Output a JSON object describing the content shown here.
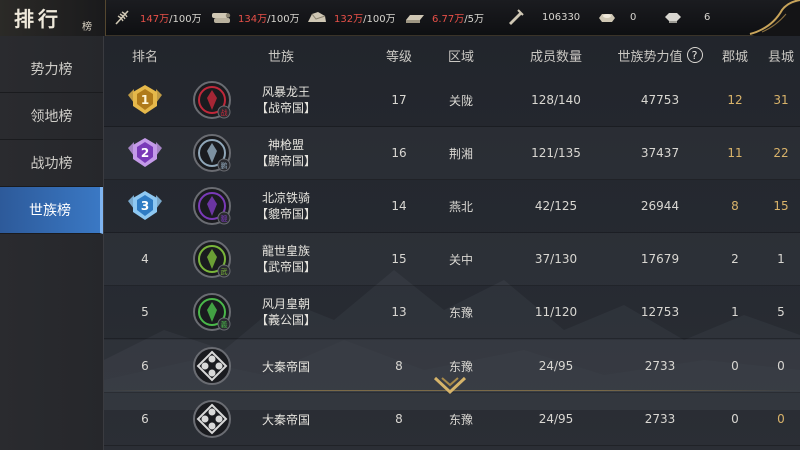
{
  "title": {
    "main": "排行",
    "sub": "榜"
  },
  "resources": [
    {
      "icon": "wheat-icon",
      "current": "147万",
      "max": "/100万"
    },
    {
      "icon": "wood-icon",
      "current": "134万",
      "max": "/100万"
    },
    {
      "icon": "stone-icon",
      "current": "132万",
      "max": "/100万"
    },
    {
      "icon": "iron-icon",
      "current": "6.77万",
      "max": "/5万"
    },
    {
      "icon": "copper-icon",
      "value": "106330"
    },
    {
      "icon": "gold-ingot-icon",
      "value": "0"
    },
    {
      "icon": "silver-ingot-icon",
      "value": "6"
    }
  ],
  "sidebar": {
    "items": [
      {
        "label": "势力榜",
        "active": false
      },
      {
        "label": "领地榜",
        "active": false
      },
      {
        "label": "战功榜",
        "active": false
      },
      {
        "label": "世族榜",
        "active": true
      }
    ]
  },
  "table": {
    "headers": {
      "rank": "排名",
      "clan": "世族",
      "level": "等级",
      "region": "区域",
      "members": "成员数量",
      "power": "世族势力值",
      "power_help": "?",
      "jun": "郡城",
      "xian": "县城"
    },
    "rows": [
      {
        "rank": "1",
        "badge": "gold",
        "name": "风暴龙王",
        "state": "【战帝国】",
        "emblem_char": "战",
        "emblem_color": "#c0283a",
        "level": "17",
        "region": "关陇",
        "members": "128/140",
        "power": "47753",
        "jun": "12",
        "xian": "31"
      },
      {
        "rank": "2",
        "badge": "purple",
        "name": "神枪盟",
        "state": "【鹏帝国】",
        "emblem_char": "鹏",
        "emblem_color": "#8fa6b8",
        "level": "16",
        "region": "荆湘",
        "members": "121/135",
        "power": "37437",
        "jun": "11",
        "xian": "22"
      },
      {
        "rank": "3",
        "badge": "blue",
        "name": "北凉铁骑",
        "state": "【貔帝国】",
        "emblem_char": "貔",
        "emblem_color": "#7a3ab8",
        "level": "14",
        "region": "燕北",
        "members": "42/125",
        "power": "26944",
        "jun": "8",
        "xian": "15"
      },
      {
        "rank": "4",
        "badge": "",
        "name": "龍世皇族",
        "state": "【武帝国】",
        "emblem_char": "武",
        "emblem_color": "#7ab63a",
        "level": "15",
        "region": "关中",
        "members": "37/130",
        "power": "17679",
        "jun": "2",
        "xian": "1"
      },
      {
        "rank": "5",
        "badge": "",
        "name": "风月皇朝",
        "state": "【義公国】",
        "emblem_char": "義",
        "emblem_color": "#4ab84a",
        "level": "13",
        "region": "东豫",
        "members": "11/120",
        "power": "12753",
        "jun": "1",
        "xian": "5"
      },
      {
        "rank": "6",
        "badge": "",
        "name": "大秦帝国",
        "state": "",
        "emblem_char": "",
        "emblem_color": "#d8d8d8",
        "level": "8",
        "region": "东豫",
        "members": "24/95",
        "power": "2733",
        "jun": "0",
        "xian": "0"
      },
      {
        "rank": "6",
        "badge": "",
        "name": "大秦帝国",
        "state": "",
        "emblem_char": "",
        "emblem_color": "#d8d8d8",
        "level": "8",
        "region": "东豫",
        "members": "24/95",
        "power": "2733",
        "jun": "0",
        "xian": "0"
      }
    ]
  }
}
